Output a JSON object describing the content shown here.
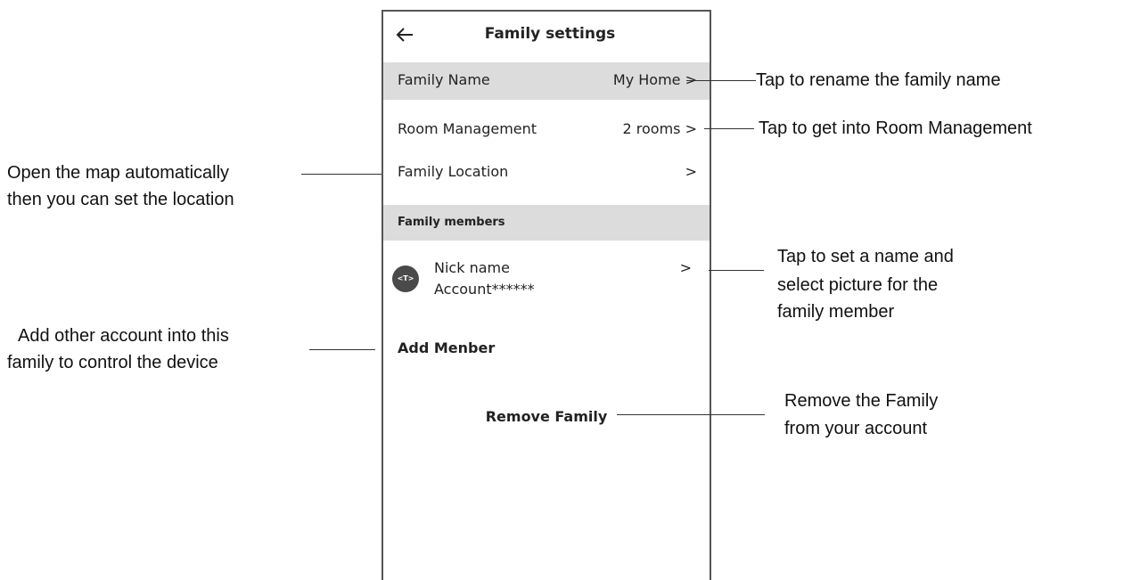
{
  "header": {
    "title": "Family settings",
    "back_icon": "arrow-left-icon"
  },
  "rows": {
    "family_name": {
      "label": "Family Name",
      "value": "My Home >"
    },
    "room_management": {
      "label": "Room Management",
      "value": "2 rooms >"
    },
    "family_location": {
      "label": "Family Location",
      "value": ">"
    }
  },
  "members_section": {
    "title": "Family members",
    "member": {
      "avatar_text": "<T>",
      "nick_name": "Nick name",
      "account": "Account******",
      "arrow": ">"
    }
  },
  "add_member_label": "Add Menber",
  "remove_family_label": "Remove Family",
  "annotations": {
    "rename": "Tap to rename the family name",
    "room": "Tap to get into Room Management",
    "location_line1": "Open the map automatically",
    "location_line2": "then you can set the location",
    "member_line1": "Tap to set a name and",
    "member_line2": "select picture for the",
    "member_line3": "family member",
    "add_line1": "Add other account into this",
    "add_line2": "family to control the device",
    "remove_line1": "Remove the Family",
    "remove_line2": "from your account"
  },
  "colors": {
    "highlight": "#dcdcdc",
    "avatar": "#4a4a4a",
    "frame": "#555555"
  }
}
